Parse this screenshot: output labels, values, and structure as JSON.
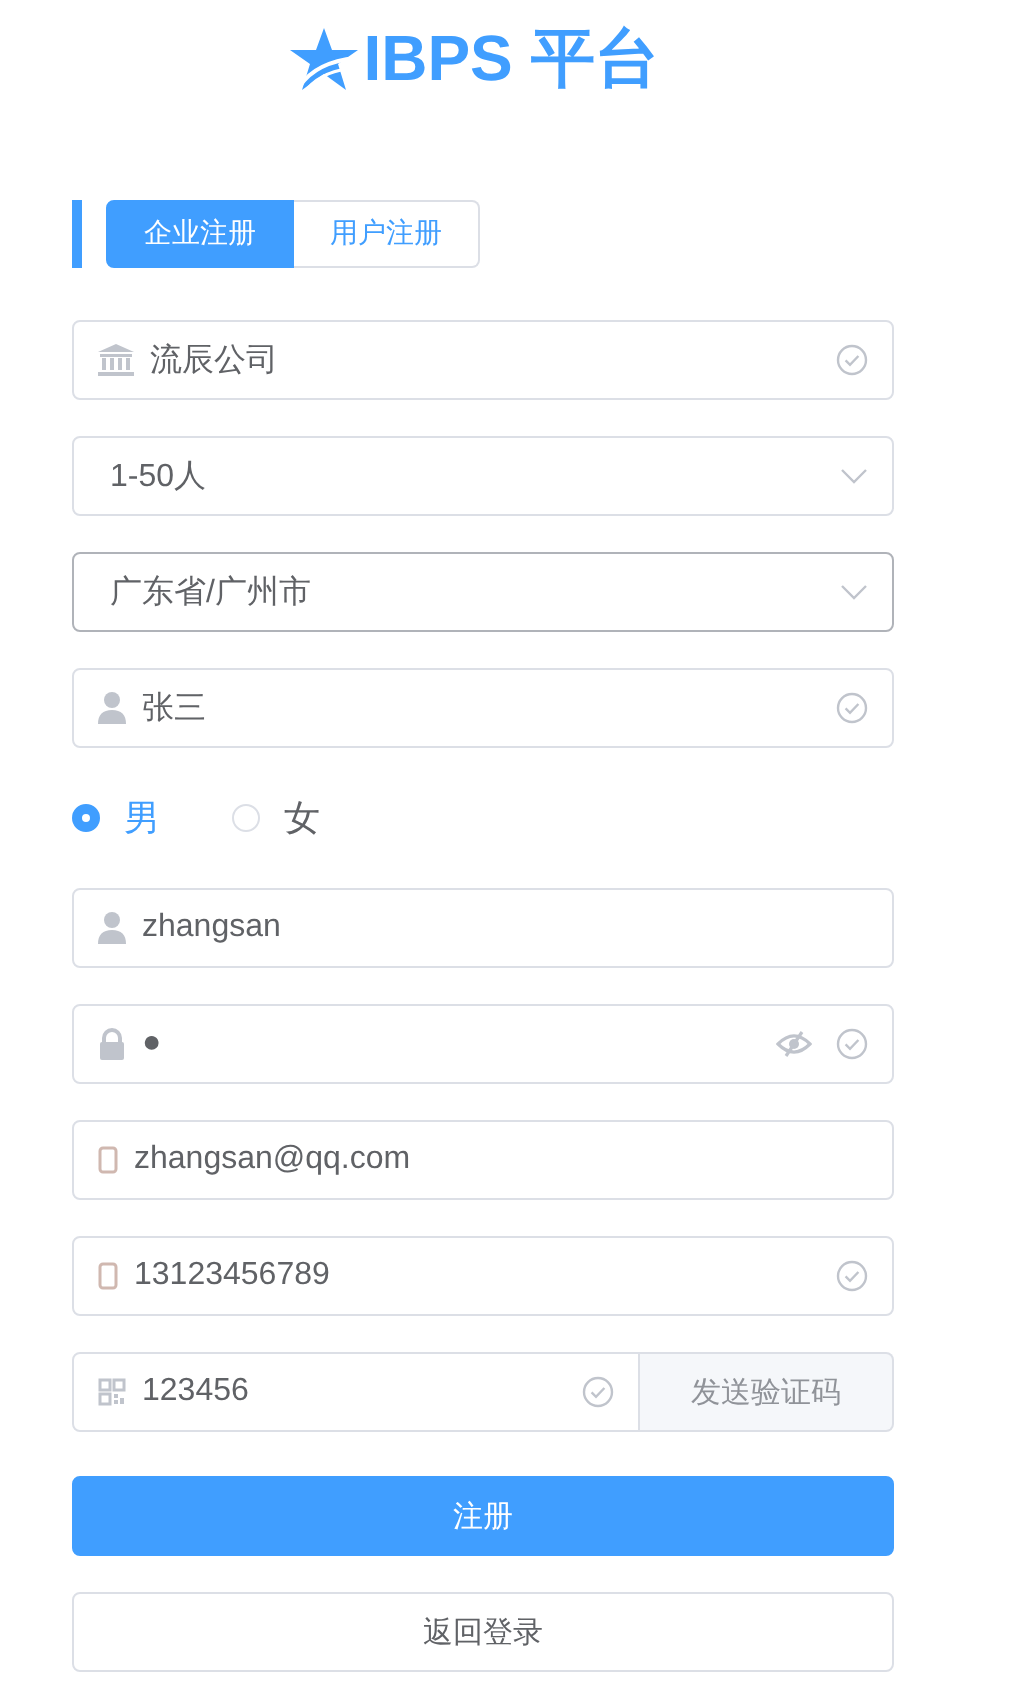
{
  "brand": {
    "title": "IBPS 平台"
  },
  "tabs": [
    {
      "label": "企业注册",
      "selected": true
    },
    {
      "label": "用户注册",
      "selected": false
    }
  ],
  "fields": [
    {
      "kind": "input",
      "value": "流辰公司",
      "validated": true
    },
    {
      "kind": "select",
      "value": "1-50人",
      "focused": false
    },
    {
      "kind": "select",
      "value": "广东省/广州市",
      "focused": true
    },
    {
      "kind": "input",
      "value": "张三",
      "validated": true
    },
    {
      "kind": "radio",
      "options": [
        {
          "label": "男",
          "selected": true
        },
        {
          "label": "女",
          "selected": false
        }
      ]
    },
    {
      "kind": "input",
      "value": "zhangsan",
      "validated": false
    },
    {
      "kind": "password",
      "value": "●",
      "validated": true
    },
    {
      "kind": "input",
      "value": "zhangsan@qq.com",
      "validated": false
    },
    {
      "kind": "input",
      "value": "13123456789",
      "validated": true
    },
    {
      "kind": "code",
      "value": "123456",
      "validated": true,
      "button": "发送验证码"
    }
  ],
  "buttons": [
    {
      "kind": "primary",
      "label": "注册"
    },
    {
      "kind": "plain",
      "label": "返回登录"
    }
  ]
}
